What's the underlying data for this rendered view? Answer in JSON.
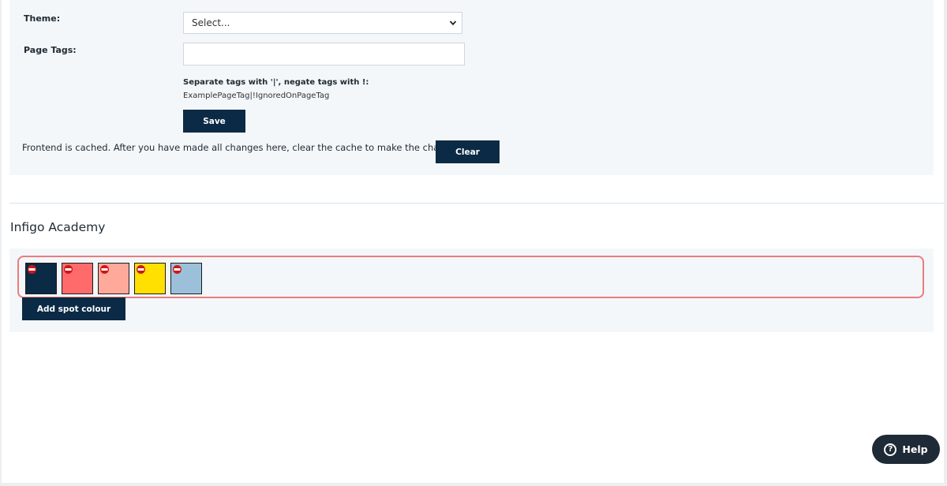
{
  "settings": {
    "theme_label": "Theme:",
    "theme_value": "Select...",
    "page_tags_label": "Page Tags:",
    "page_tags_value": "",
    "tags_help_strong": "Separate tags with '|', negate tags with !:",
    "tags_help_example": "ExamplePageTag|!IgnoredOnPageTag",
    "save_label": "Save",
    "cache_note": "Frontend is cached. After you have made all changes here, clear the cache to make the changes appear:",
    "clear_label": "Clear"
  },
  "academy": {
    "title": "Infigo Academy",
    "swatches": [
      {
        "color": "#0b2a45",
        "icon": "remove-icon"
      },
      {
        "color": "#ff6b6b",
        "icon": "remove-icon"
      },
      {
        "color": "#ffa99a",
        "icon": "remove-icon"
      },
      {
        "color": "#ffe000",
        "icon": "remove-icon"
      },
      {
        "color": "#9cc0da",
        "icon": "remove-icon"
      }
    ],
    "add_label": "Add spot colour"
  },
  "help": {
    "label": "Help",
    "icon": "question-icon"
  },
  "colors": {
    "accent_dark": "#0b2a45",
    "panel_bg": "#f3f7fa",
    "highlight": "#ea7d7c"
  }
}
